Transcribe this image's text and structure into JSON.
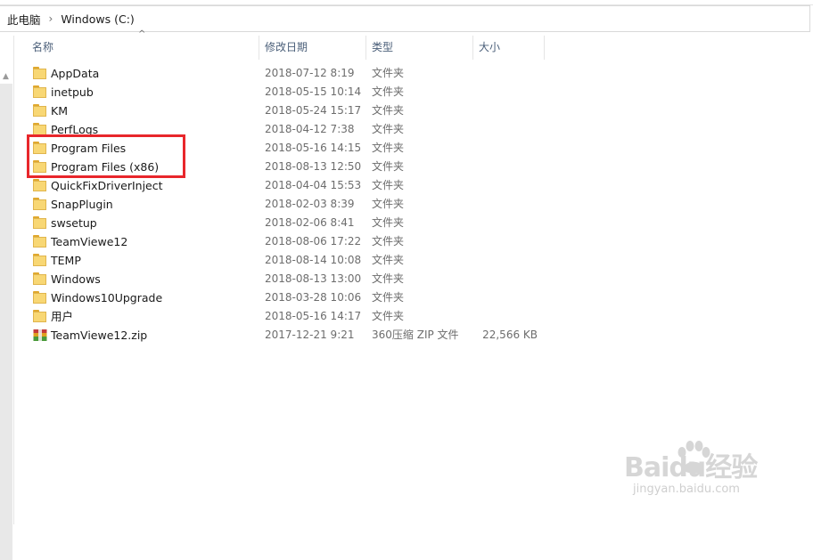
{
  "breadcrumb": {
    "items": [
      "此电脑",
      "Windows (C:)"
    ],
    "separator": "›"
  },
  "columns": {
    "name": "名称",
    "date": "修改日期",
    "type": "类型",
    "size": "大小"
  },
  "files": [
    {
      "name": "AppData",
      "date": "2018-07-12 8:19",
      "type": "文件夹",
      "size": "",
      "icon": "folder-icon"
    },
    {
      "name": "inetpub",
      "date": "2018-05-15 10:14",
      "type": "文件夹",
      "size": "",
      "icon": "folder-icon"
    },
    {
      "name": "KM",
      "date": "2018-05-24 15:17",
      "type": "文件夹",
      "size": "",
      "icon": "folder-icon"
    },
    {
      "name": "PerfLogs",
      "date": "2018-04-12 7:38",
      "type": "文件夹",
      "size": "",
      "icon": "folder-icon"
    },
    {
      "name": "Program Files",
      "date": "2018-05-16 14:15",
      "type": "文件夹",
      "size": "",
      "icon": "folder-icon"
    },
    {
      "name": "Program Files (x86)",
      "date": "2018-08-13 12:50",
      "type": "文件夹",
      "size": "",
      "icon": "folder-icon"
    },
    {
      "name": "QuickFixDriverInject",
      "date": "2018-04-04 15:53",
      "type": "文件夹",
      "size": "",
      "icon": "folder-icon"
    },
    {
      "name": "SnapPlugin",
      "date": "2018-02-03 8:39",
      "type": "文件夹",
      "size": "",
      "icon": "folder-icon"
    },
    {
      "name": "swsetup",
      "date": "2018-02-06 8:41",
      "type": "文件夹",
      "size": "",
      "icon": "folder-icon"
    },
    {
      "name": "TeamViewe12",
      "date": "2018-08-06 17:22",
      "type": "文件夹",
      "size": "",
      "icon": "folder-icon"
    },
    {
      "name": "TEMP",
      "date": "2018-08-14 10:08",
      "type": "文件夹",
      "size": "",
      "icon": "folder-icon"
    },
    {
      "name": "Windows",
      "date": "2018-08-13 13:00",
      "type": "文件夹",
      "size": "",
      "icon": "folder-icon"
    },
    {
      "name": "Windows10Upgrade",
      "date": "2018-03-28 10:06",
      "type": "文件夹",
      "size": "",
      "icon": "folder-icon"
    },
    {
      "name": "用户",
      "date": "2018-05-16 14:17",
      "type": "文件夹",
      "size": "",
      "icon": "folder-icon"
    },
    {
      "name": "TeamViewe12.zip",
      "date": "2017-12-21 9:21",
      "type": "360压缩 ZIP 文件",
      "size": "22,566 KB",
      "icon": "zip-archive-icon"
    }
  ],
  "annotation": {
    "color": "#e8262b"
  },
  "watermark": {
    "brand": "Baidu经验",
    "url": "jingyan.baidu.com"
  },
  "colors": {
    "folder": "#f8d774",
    "header_text": "#4c607a",
    "secondary_text": "#6d6d6d"
  }
}
